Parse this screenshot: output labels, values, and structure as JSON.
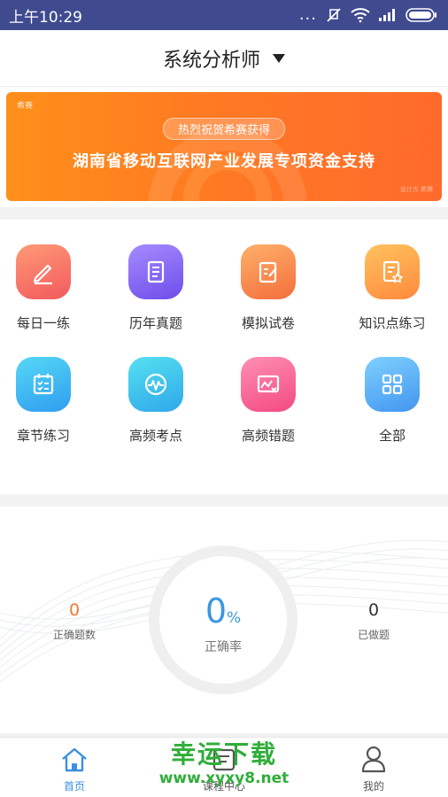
{
  "status_bar": {
    "time": "上午10:29",
    "dots": "..."
  },
  "header": {
    "title": "系统分析师"
  },
  "banner": {
    "brand": "希赛",
    "pill": "热烈祝贺希赛获得",
    "headline": "湖南省移动互联网产业发展专项资金支持",
    "corner": "设计方 希赛"
  },
  "grid": [
    {
      "label": "每日一练",
      "icon": "pencil-icon",
      "gradient": [
        "#ff9a76",
        "#f2595e"
      ]
    },
    {
      "label": "历年真题",
      "icon": "document-icon",
      "gradient": [
        "#a58bff",
        "#6f4dea"
      ]
    },
    {
      "label": "模拟试卷",
      "icon": "edit-paper-icon",
      "gradient": [
        "#ffb06a",
        "#f36e3c"
      ]
    },
    {
      "label": "知识点练习",
      "icon": "star-document-icon",
      "gradient": [
        "#ffc25e",
        "#ff8a3d"
      ]
    },
    {
      "label": "章节练习",
      "icon": "checklist-icon",
      "gradient": [
        "#56d8f5",
        "#2f9df0"
      ]
    },
    {
      "label": "高频考点",
      "icon": "wave-chart-icon",
      "gradient": [
        "#55e0f0",
        "#2fa8ea"
      ]
    },
    {
      "label": "高频错题",
      "icon": "error-chart-icon",
      "gradient": [
        "#ff8fb4",
        "#f34a80"
      ]
    },
    {
      "label": "全部",
      "icon": "grid-icon",
      "gradient": [
        "#7fd0ff",
        "#4296f0"
      ]
    }
  ],
  "stats": {
    "correct_count": {
      "value": "0",
      "label": "正确题数",
      "color": "#f07c2f"
    },
    "accuracy": {
      "value": "0",
      "unit": "%",
      "label": "正确率",
      "color": "#3b97e0"
    },
    "done_count": {
      "value": "0",
      "label": "已做题",
      "color": "#333333"
    }
  },
  "tabs": [
    {
      "label": "首页",
      "icon": "home-icon",
      "active": true,
      "color": "#3b8fe0"
    },
    {
      "label": "课程中心",
      "icon": "course-icon",
      "active": false,
      "color": "#555555"
    },
    {
      "label": "我的",
      "icon": "person-icon",
      "active": false,
      "color": "#555555"
    }
  ],
  "watermark": {
    "line1": "幸运下载",
    "line2": "www.xyxy8.net"
  }
}
